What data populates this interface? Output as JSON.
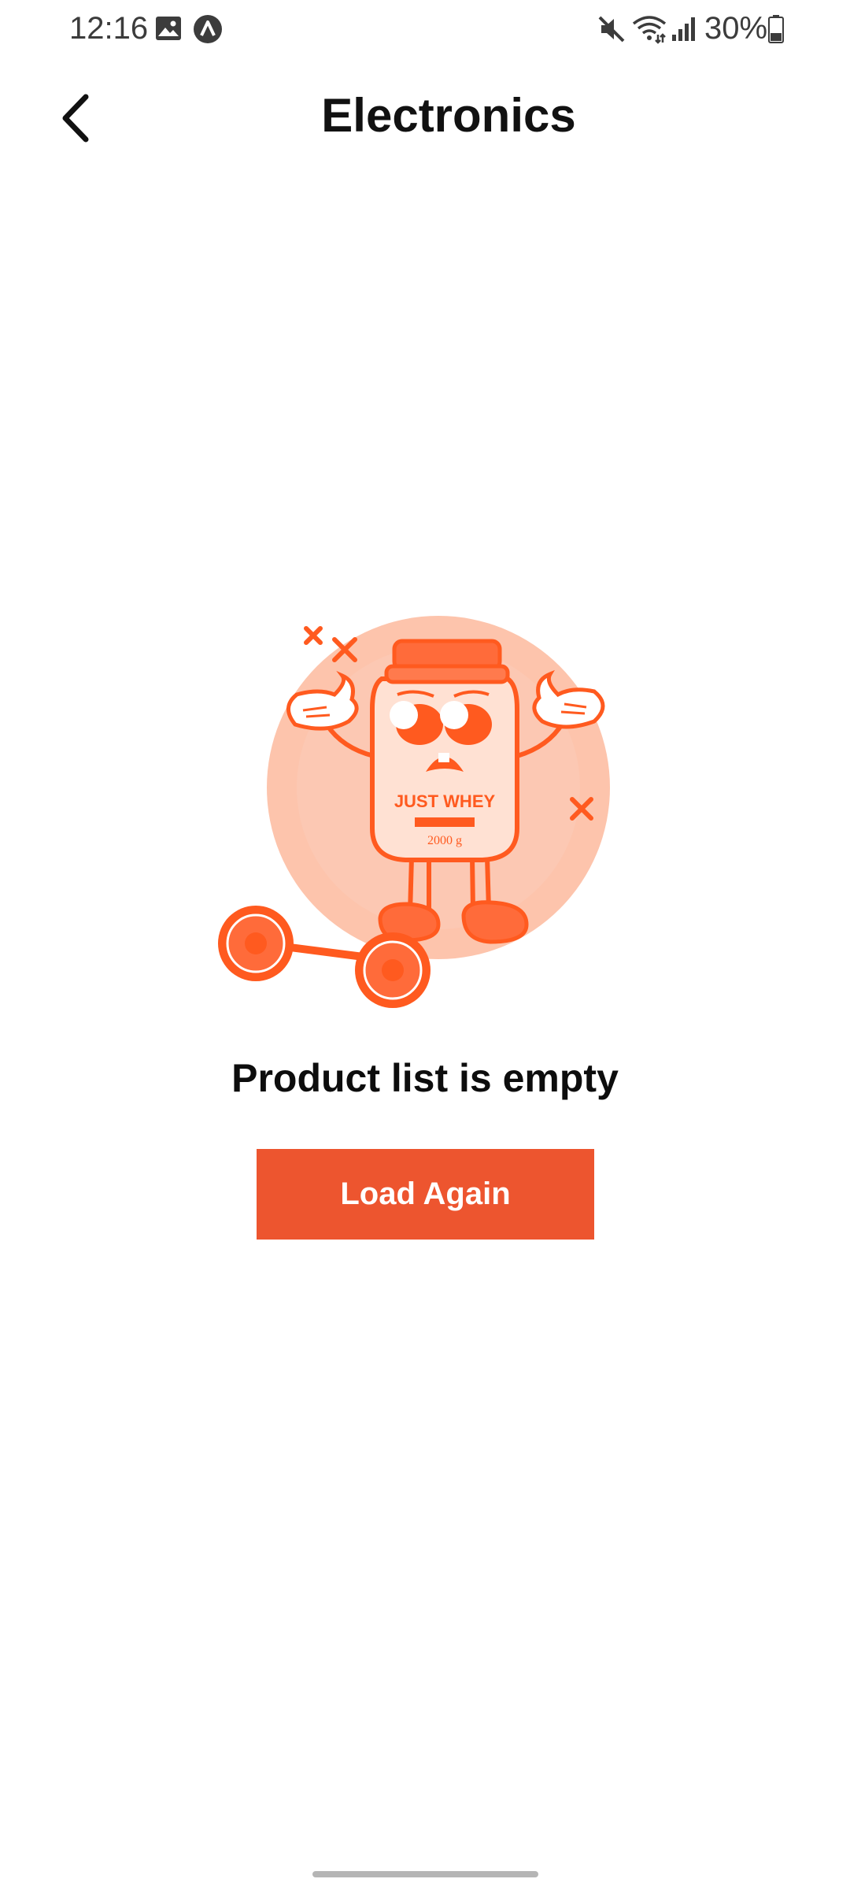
{
  "status_bar": {
    "time": "12:16",
    "battery_text": "30%",
    "icons": [
      "gallery-icon",
      "app-notification-icon",
      "mute-icon",
      "wifi-icon",
      "signal-icon",
      "battery-icon"
    ]
  },
  "header": {
    "title": "Electronics",
    "back_icon": "chevron-left-icon"
  },
  "illustration": {
    "label_text": "JUST WHEY",
    "weight_text": "2000 g",
    "colors": {
      "accent": "#ff5a1f",
      "circle": "#fdc4ac",
      "light": "#ffe1d3"
    }
  },
  "empty_state": {
    "message": "Product list is empty",
    "button_label": "Load Again",
    "button_color": "#ed552f"
  }
}
